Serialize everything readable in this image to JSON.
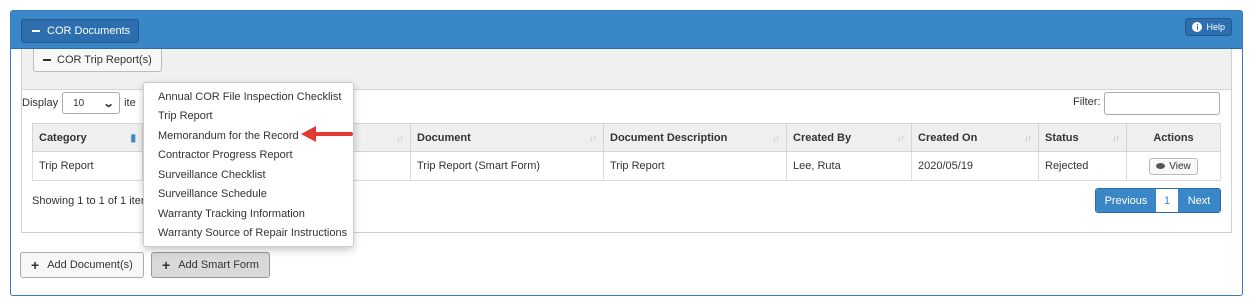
{
  "panel": {
    "title": "COR Documents",
    "help_label": "Help"
  },
  "sub_panel": {
    "title": "COR Trip Report(s)"
  },
  "table_controls": {
    "display_label": "Display",
    "page_size": "10",
    "items_label": "ite",
    "filter_label": "Filter:",
    "filter_value": ""
  },
  "table": {
    "columns": [
      "Category",
      "",
      "Document",
      "Document Description",
      "Created By",
      "Created On",
      "Status",
      "Actions"
    ],
    "rows": [
      {
        "category": "Trip Report",
        "col2": "",
        "document": "Trip Report (Smart Form)",
        "description": "Trip Report",
        "created_by": "Lee, Ruta",
        "created_on": "2020/05/19",
        "status": "Rejected",
        "action": "View"
      }
    ]
  },
  "footer": {
    "showing": "Showing 1 to 1 of 1 item",
    "pagination": {
      "previous": "Previous",
      "current": "1",
      "next": "Next"
    }
  },
  "buttons": {
    "add_document": "Add Document(s)",
    "add_smart_form": "Add Smart Form"
  },
  "dropdown": {
    "items": [
      "Annual COR File Inspection Checklist",
      "Trip Report",
      "Memorandum for the Record",
      "Contractor Progress Report",
      "Surveillance Checklist",
      "Surveillance Schedule",
      "Warranty Tracking Information",
      "Warranty Source of Repair Instructions"
    ]
  },
  "colors": {
    "primary": "#3a87c8",
    "primary_dark": "#2d6fae",
    "annotation_arrow": "#e53935"
  },
  "icons": [
    "minus-icon",
    "info-icon",
    "chevron-down-icon",
    "sort-icon",
    "eye-icon",
    "plus-icon",
    "arrow-annotation"
  ]
}
